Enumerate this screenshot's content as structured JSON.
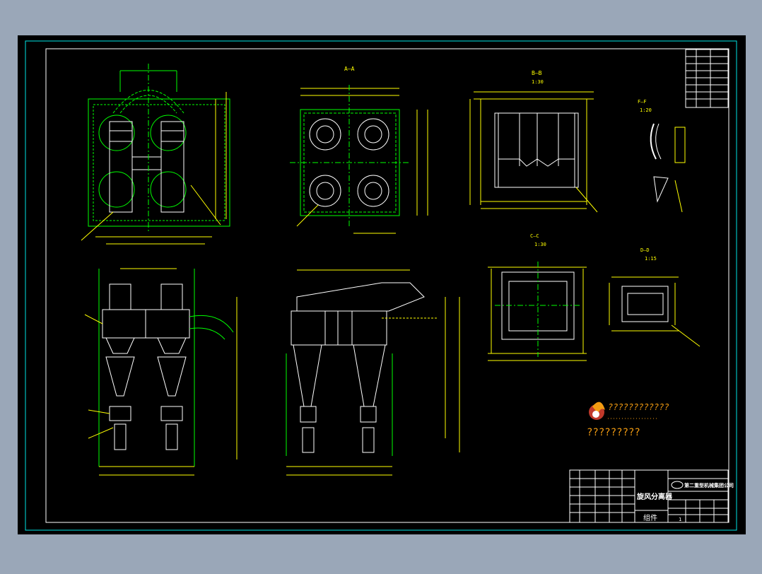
{
  "sheet": {
    "background": "#000000",
    "frame_color": "#00e5e5",
    "line_color": "#00ff00",
    "part_color": "#ffffff",
    "dim_color": "#ffff00"
  },
  "views": {
    "section_aa": "A–A",
    "section_bb": "B–B",
    "section_bb_scale": "1:30",
    "section_ff": "F–F",
    "section_ff_scale": "1:20",
    "section_cc": "C–C",
    "section_cc_scale": "1:30",
    "section_dd": "D–D",
    "section_dd_scale": "1:15"
  },
  "logo": {
    "line1": "????????????",
    "line2": "?????????"
  },
  "title_block": {
    "drawing_title": "旋风分离器",
    "company": "第二重型机械集团公司",
    "category": "组件",
    "sheet_no": "1"
  }
}
